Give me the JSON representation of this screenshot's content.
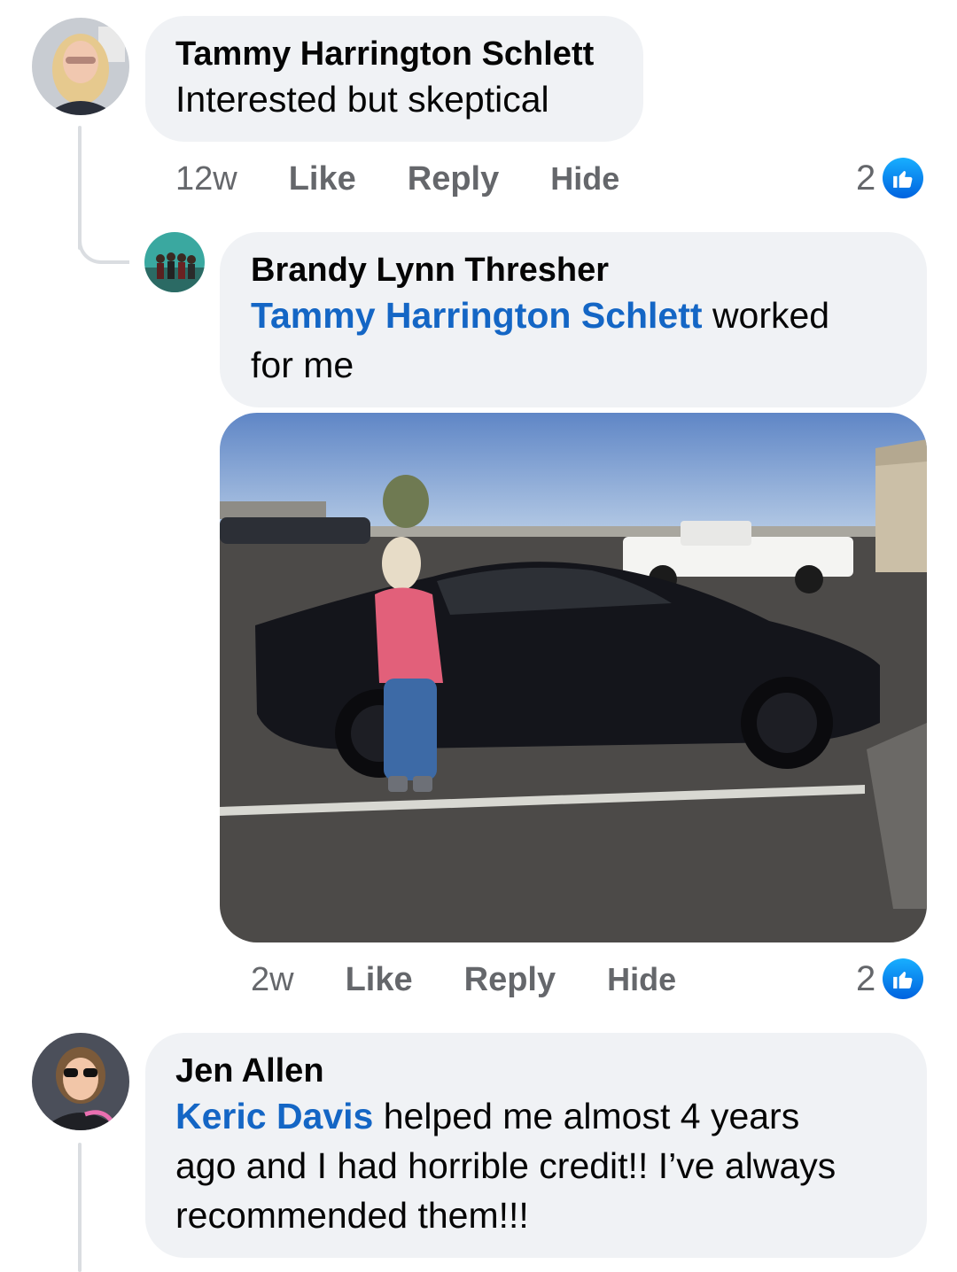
{
  "comments": [
    {
      "author": "Tammy Harrington Schlett",
      "text": "Interested but skeptical",
      "time": "12w",
      "like": "Like",
      "reply": "Reply",
      "hide": "Hide",
      "reaction_count": "2",
      "reaction_icon": "thumbs-up-icon"
    },
    {
      "author": "Brandy Lynn Thresher",
      "mention": "Tammy Harrington Schlett",
      "text_line1": " worked",
      "text_line2": "for me",
      "time": "2w",
      "like": "Like",
      "reply": "Reply",
      "hide": "Hide",
      "reaction_count": "2",
      "reaction_icon": "thumbs-up-icon"
    },
    {
      "author": "Jen Allen",
      "mention": "Keric Davis",
      "text_line1": " helped me almost 4 years",
      "text_line2": "ago and I had horrible credit!! I’ve always",
      "text_line3": "recommended them!!!"
    }
  ],
  "colors": {
    "bubble": "#f0f2f5",
    "mention": "#1466c5",
    "meta": "#65676b",
    "like_blue": "#0a7cff"
  }
}
